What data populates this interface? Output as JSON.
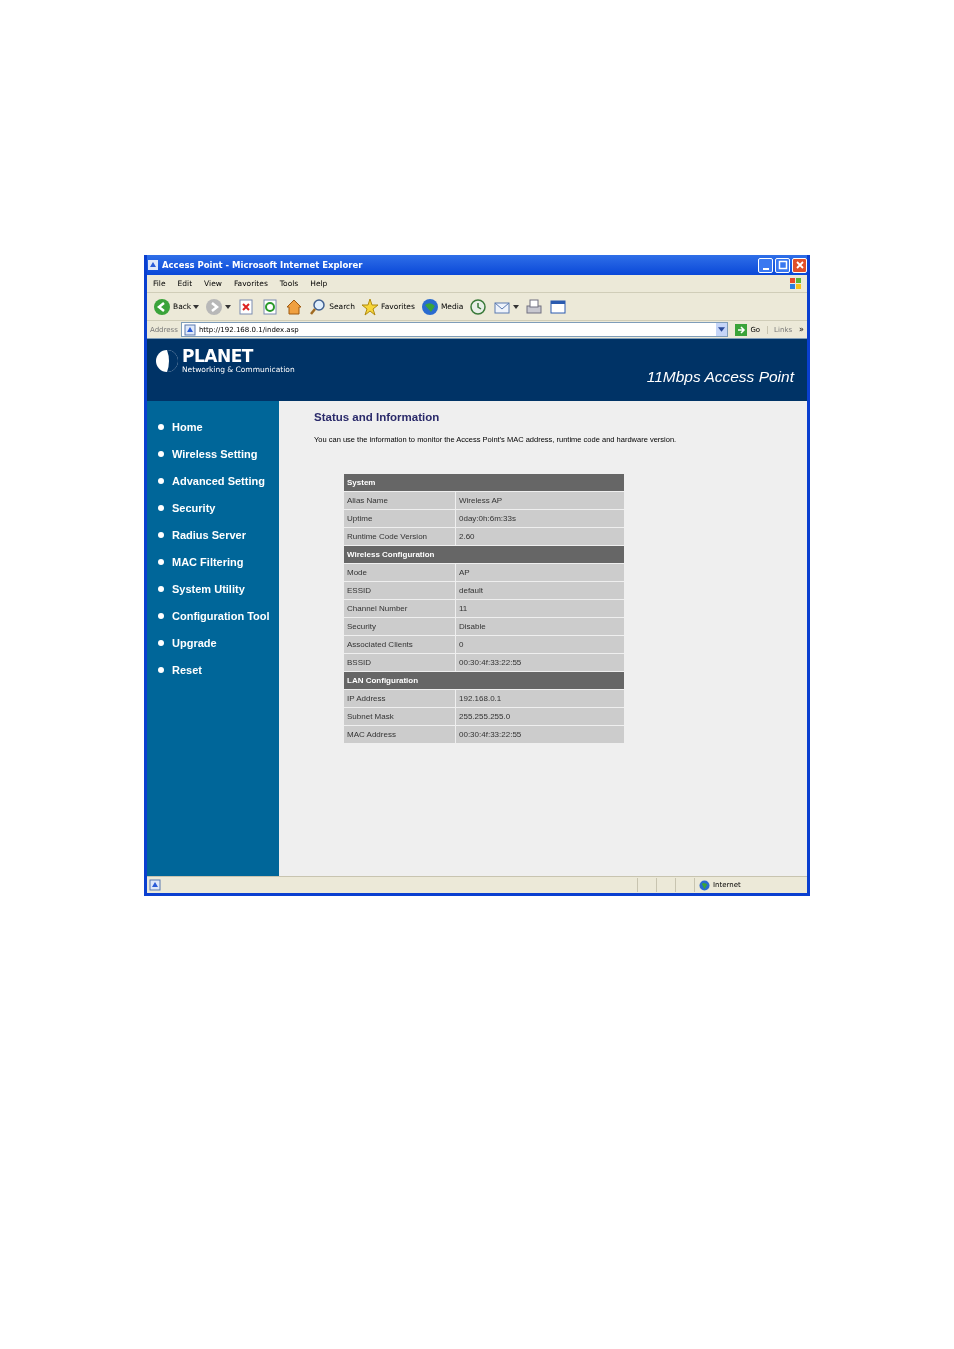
{
  "window": {
    "title": "Access Point - Microsoft Internet Explorer"
  },
  "menu": [
    "File",
    "Edit",
    "View",
    "Favorites",
    "Tools",
    "Help"
  ],
  "toolbar": [
    {
      "label": "Back",
      "dropdown": true
    },
    {
      "dropdown": true
    },
    {
      "dropdown": false
    },
    {
      "dropdown": false
    },
    {
      "dropdown": false
    },
    {
      "label": "Search",
      "dropdown": false
    },
    {
      "label": "Favorites",
      "dropdown": false
    },
    {
      "label": "Media",
      "dropdown": false
    },
    {
      "dropdown": false
    },
    {
      "dropdown": true
    },
    {
      "dropdown": false
    },
    {
      "dropdown": false
    }
  ],
  "address_bar": {
    "label": "Address",
    "value": "http://192.168.0.1/index.asp",
    "go": "Go",
    "links": "Links",
    "more": "»"
  },
  "header": {
    "logo": "PLANET",
    "tagline": "Networking & Communication",
    "title": "11Mbps Access Point"
  },
  "sidebar": {
    "items": [
      {
        "label": "Home",
        "selected": false
      },
      {
        "label": "Wireless Setting",
        "selected": false
      },
      {
        "label": "Advanced Setting",
        "selected": false
      },
      {
        "label": "Security",
        "selected": false
      },
      {
        "label": "Radius Server",
        "selected": false
      },
      {
        "label": "MAC Filtering",
        "selected": false
      },
      {
        "label": "System Utility",
        "selected": false
      },
      {
        "label": "Configuration Tool",
        "selected": false
      },
      {
        "label": "Upgrade",
        "selected": false
      },
      {
        "label": "Reset",
        "selected": false
      }
    ]
  },
  "main": {
    "heading": "Status and Information",
    "description": "You can use the information to monitor the Access Point's MAC address, runtime code and hardware version.",
    "sections": [
      {
        "title": "System",
        "rows": [
          {
            "label": "Alias Name",
            "value": "Wireless AP"
          },
          {
            "label": "Uptime",
            "value": "0day:0h:6m:33s"
          },
          {
            "label": "Runtime Code Version",
            "value": "2.60"
          }
        ]
      },
      {
        "title": "Wireless Configuration",
        "rows": [
          {
            "label": "Mode",
            "value": "AP"
          },
          {
            "label": "ESSID",
            "value": "default"
          },
          {
            "label": "Channel Number",
            "value": "11"
          },
          {
            "label": "Security",
            "value": "Disable"
          },
          {
            "label": "Associated Clients",
            "value": "0"
          },
          {
            "label": "BSSID",
            "value": "00:30:4f:33:22:55"
          }
        ]
      },
      {
        "title": "LAN Configuration",
        "rows": [
          {
            "label": "IP Address",
            "value": "192.168.0.1"
          },
          {
            "label": "Subnet Mask",
            "value": "255.255.255.0"
          },
          {
            "label": "MAC Address",
            "value": "00:30:4f:33:22:55"
          }
        ]
      }
    ]
  },
  "status_bar": {
    "zone": "Internet"
  }
}
